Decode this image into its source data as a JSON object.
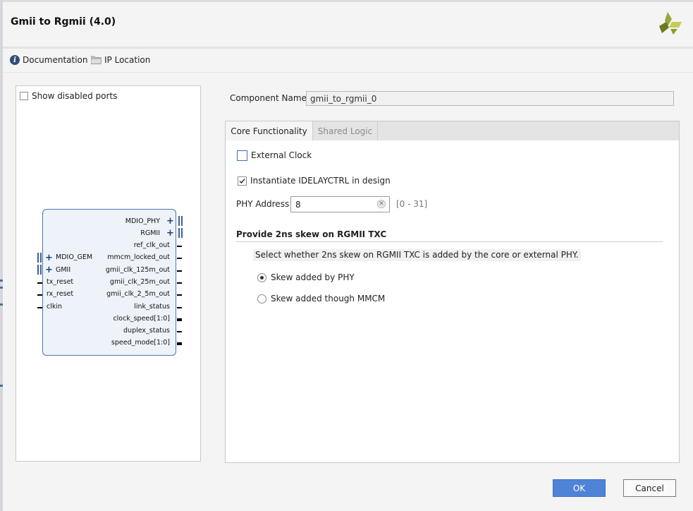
{
  "window": {
    "title": "Gmii to Rgmii (4.0)",
    "logo_icon": "vivado-logo-icon"
  },
  "toolbar": {
    "documentation_label": "Documentation",
    "documentation_icon": "info-icon",
    "ip_location_label": "IP Location",
    "ip_location_icon": "folder-icon"
  },
  "left_panel": {
    "show_disabled_ports_label": "Show disabled ports",
    "show_disabled_ports_checked": false,
    "ip_symbol": {
      "right_ports": [
        "MDIO_PHY",
        "RGMII",
        "ref_clk_out",
        "mmcm_locked_out",
        "gmii_clk_125m_out",
        "gmii_clk_25m_out",
        "gmii_clk_2_5m_out",
        "link_status",
        "clock_speed[1:0]",
        "duplex_status",
        "speed_mode[1:0]"
      ],
      "left_ports": [
        "MDIO_GEM",
        "GMII",
        "tx_reset",
        "rx_reset",
        "clkin"
      ]
    }
  },
  "component": {
    "label": "Component Name",
    "value": "gmii_to_rgmii_0"
  },
  "tabs": [
    "Core Functionality",
    "Shared Logic"
  ],
  "core": {
    "external_clock_label": "External Clock",
    "external_clock_checked": false,
    "idelayctrl_label": "Instantiate IDELAYCTRL in design",
    "idelayctrl_checked": true,
    "phy_address_label": "PHY Address",
    "phy_address_value": "8",
    "phy_address_range": "[0 - 31]",
    "skew_section_title": "Provide 2ns skew on RGMII TXC",
    "skew_description": "Select whether 2ns skew on RGMII TXC is added by the core or external PHY.",
    "skew_options": [
      "Skew added by PHY",
      "Skew added though MMCM"
    ],
    "skew_selected": "Skew added by PHY"
  },
  "buttons": {
    "ok": "OK",
    "cancel": "Cancel"
  },
  "colors": {
    "accent": "#4f83d6",
    "block_border": "#4f75ad",
    "block_fill": "#eef3fa"
  }
}
